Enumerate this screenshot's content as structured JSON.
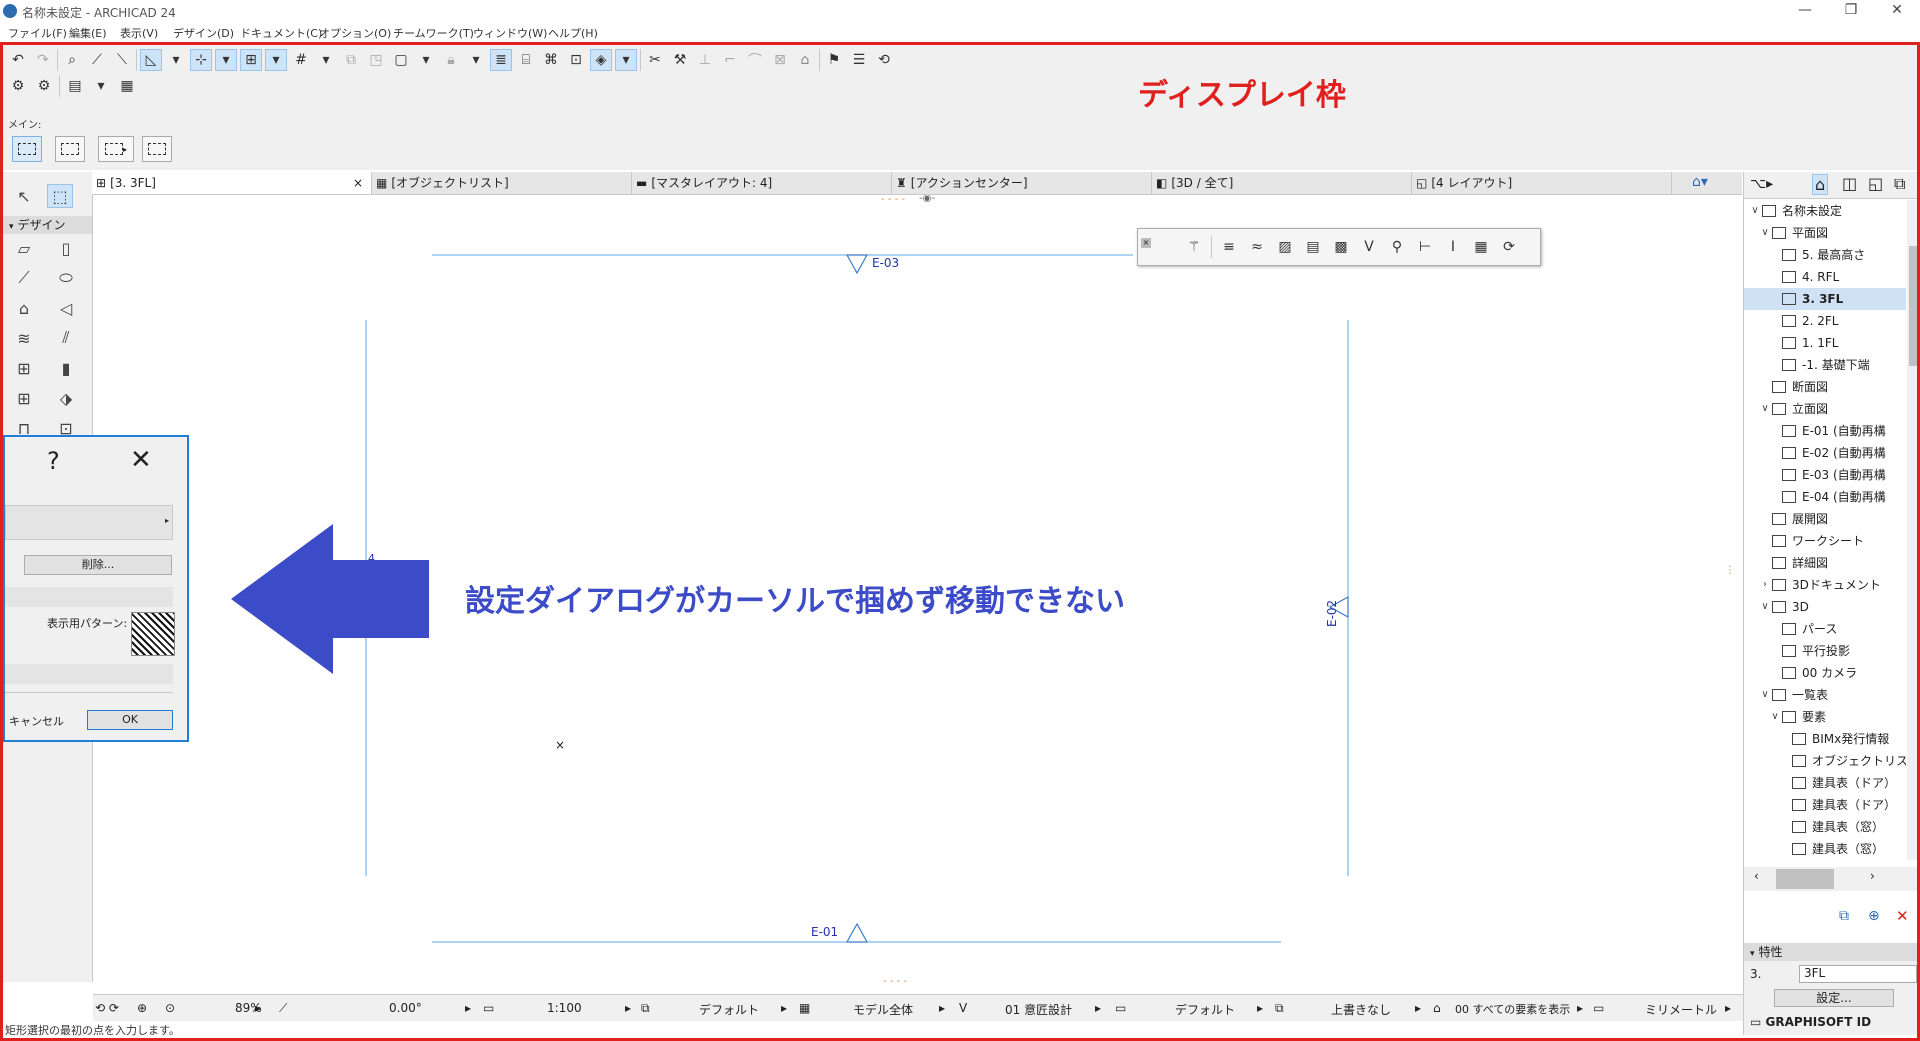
{
  "window": {
    "title": "名称未設定 - ARCHICAD 24",
    "controls": [
      "—",
      "❐",
      "✕"
    ]
  },
  "menus": [
    "ファイル(F)",
    "編集(E)",
    "表示(V)",
    "デザイン(D)",
    "ドキュメント(C)",
    "オプション(O)",
    "チームワーク(T)",
    "ウィンドウ(W)",
    "ヘルプ(H)"
  ],
  "toolbar": {
    "main_label": "メイン:"
  },
  "annotations": {
    "display_frame_label": "ディスプレイ枠",
    "issue_text": "設定ダイアログがカーソルで掴めず移動できない",
    "accent_red": "#e0201c",
    "accent_blue": "#3c4bc7"
  },
  "tabs": [
    {
      "label": "[3. 3FL]",
      "icon": "floor-plan-icon",
      "active": true,
      "close": "×"
    },
    {
      "label": "[オブジェクトリスト]",
      "icon": "schedule-icon"
    },
    {
      "label": "[マスタレイアウト: 4]",
      "icon": "master-layout-icon"
    },
    {
      "label": "[アクションセンター]",
      "icon": "action-center-icon"
    },
    {
      "label": "[3D / 全て]",
      "icon": "3d-icon"
    },
    {
      "label": "[4 レイアウト]",
      "icon": "layout-icon"
    }
  ],
  "toolbox": {
    "section": "デザイン"
  },
  "canvas": {
    "markers": {
      "top": "E-03",
      "bottom": "E-01",
      "right": "E-02",
      "left": "4"
    },
    "cursor_mark": "×",
    "eye_handle": "-◉-",
    "dashes": "- - - -"
  },
  "dialog": {
    "help": "?",
    "close": "✕",
    "delete_label": "削除...",
    "pattern_label": "表示用パターン:",
    "cancel_label": "キャンセル",
    "ok_label": "OK"
  },
  "navigator": {
    "items": [
      {
        "label": "名称未設定",
        "level": 0,
        "arrow": "∨"
      },
      {
        "label": "平面図",
        "level": 1,
        "arrow": "∨"
      },
      {
        "label": "5. 最高高さ",
        "level": 2
      },
      {
        "label": "4. RFL",
        "level": 2
      },
      {
        "label": "3. 3FL",
        "level": 2,
        "selected": true
      },
      {
        "label": "2. 2FL",
        "level": 2
      },
      {
        "label": "1. 1FL",
        "level": 2
      },
      {
        "label": "-1. 基礎下端",
        "level": 2
      },
      {
        "label": "断面図",
        "level": 1
      },
      {
        "label": "立面図",
        "level": 1,
        "arrow": "∨"
      },
      {
        "label": "E-01 (自動再構",
        "level": 2
      },
      {
        "label": "E-02 (自動再構",
        "level": 2
      },
      {
        "label": "E-03 (自動再構",
        "level": 2
      },
      {
        "label": "E-04 (自動再構",
        "level": 2
      },
      {
        "label": "展開図",
        "level": 1
      },
      {
        "label": "ワークシート",
        "level": 1
      },
      {
        "label": "詳細図",
        "level": 1
      },
      {
        "label": "3Dドキュメント",
        "level": 1,
        "arrow": "›"
      },
      {
        "label": "3D",
        "level": 1,
        "arrow": "∨"
      },
      {
        "label": "パース",
        "level": 2
      },
      {
        "label": "平行投影",
        "level": 2
      },
      {
        "label": "00 カメラ",
        "level": 2
      },
      {
        "label": "一覧表",
        "level": 1,
        "arrow": "∨"
      },
      {
        "label": "要素",
        "level": 2,
        "arrow": "∨"
      },
      {
        "label": "BIMx発行情報",
        "level": 3
      },
      {
        "label": "オブジェクトリスト",
        "level": 3
      },
      {
        "label": "建具表（ドア）",
        "level": 3
      },
      {
        "label": "建具表（ドア）",
        "level": 3
      },
      {
        "label": "建具表（窓）",
        "level": 3
      },
      {
        "label": "建具表（窓）",
        "level": 3
      }
    ]
  },
  "properties": {
    "header": "特性",
    "story_id": "3.",
    "story_name": "3FL",
    "settings": "設定...",
    "graphisoft": "GRAPHISOFT ID"
  },
  "statusbar": {
    "zoom": "89%",
    "angle": "0.00°",
    "scale": "1:100",
    "layer_combo": "デフォルト",
    "model_view": "モデル全体",
    "mvo": "01 意匠設計",
    "pen_set": "デフォルト",
    "override": "上書きなし",
    "renovation": "00 すべての要素を表示",
    "units": "ミリメートル",
    "hint": "矩形選択の最初の点を入力します。"
  }
}
